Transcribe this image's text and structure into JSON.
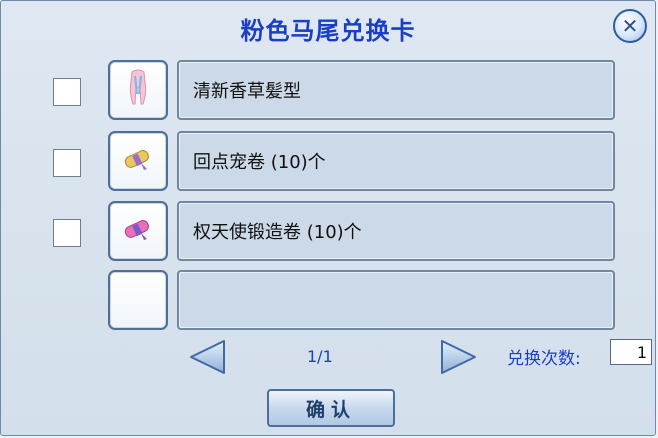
{
  "dialog": {
    "title": "粉色马尾兑换卡",
    "close_icon": "close-icon"
  },
  "items": [
    {
      "name": "清新香草髪型",
      "icon": "hairstyle-icon",
      "checked": false
    },
    {
      "name": "回点宠卷 (10)个",
      "icon": "scroll-gold-icon",
      "checked": false
    },
    {
      "name": "权天使锻造卷 (10)个",
      "icon": "scroll-pink-icon",
      "checked": false
    },
    {
      "name": "",
      "icon": "",
      "checked": false
    }
  ],
  "pager": {
    "page_text": "1/1",
    "prev_icon": "prev-arrow-icon",
    "next_icon": "next-arrow-icon"
  },
  "exchange": {
    "count_label": "兑换次数:",
    "count_value": "1"
  },
  "confirm_label": "确认",
  "colors": {
    "accent": "#1b3ec9",
    "panel_bg": "#d7e2ed",
    "row_bg": "#ccd9e8"
  }
}
